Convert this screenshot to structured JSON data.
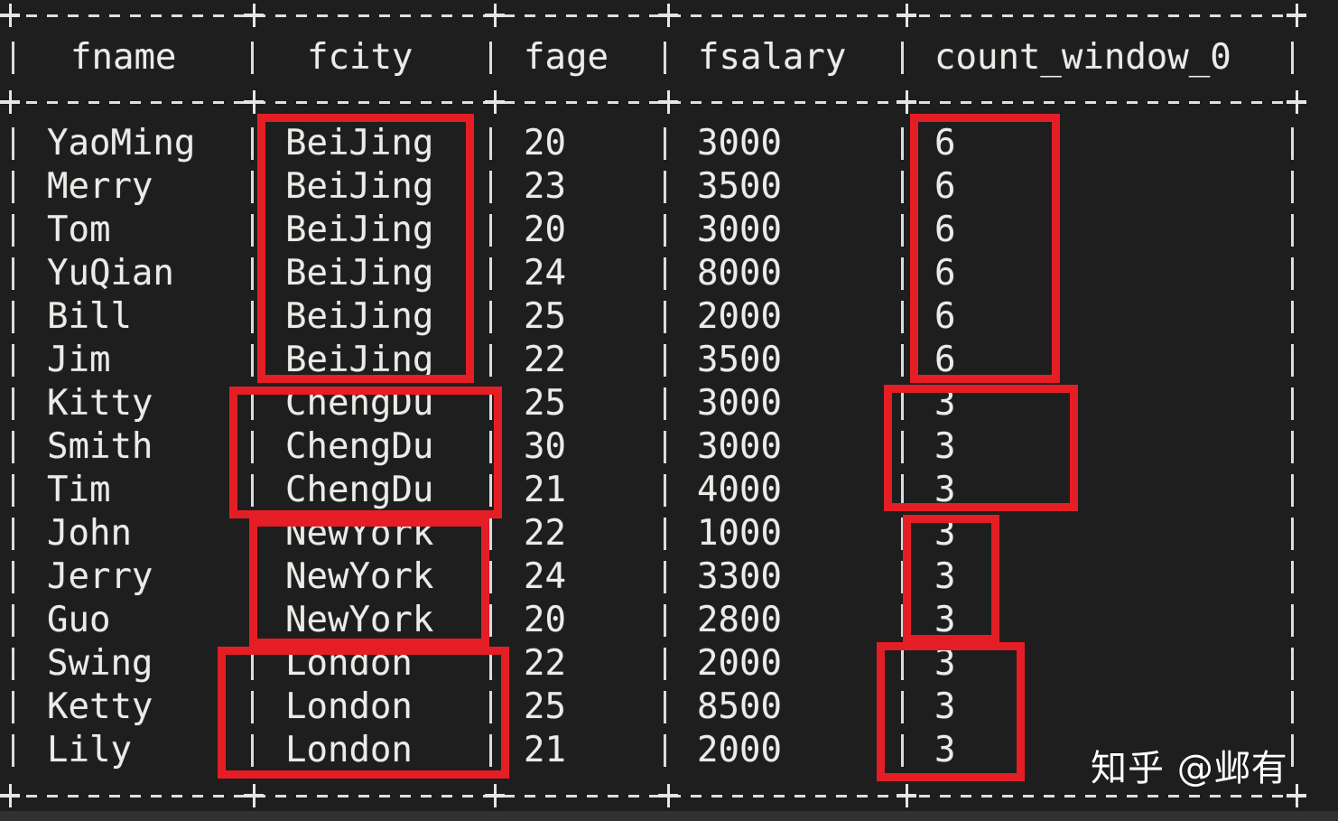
{
  "table": {
    "columns": [
      "fname",
      "fcity",
      "fage",
      "fsalary",
      "count_window_0"
    ],
    "rows": [
      [
        "YaoMing",
        "BeiJing",
        "20",
        "3000",
        "6"
      ],
      [
        "Merry",
        "BeiJing",
        "23",
        "3500",
        "6"
      ],
      [
        "Tom",
        "BeiJing",
        "20",
        "3000",
        "6"
      ],
      [
        "YuQian",
        "BeiJing",
        "24",
        "8000",
        "6"
      ],
      [
        "Bill",
        "BeiJing",
        "25",
        "2000",
        "6"
      ],
      [
        "Jim",
        "BeiJing",
        "22",
        "3500",
        "6"
      ],
      [
        "Kitty",
        "ChengDu",
        "25",
        "3000",
        "3"
      ],
      [
        "Smith",
        "ChengDu",
        "30",
        "3000",
        "3"
      ],
      [
        "Tim",
        "ChengDu",
        "21",
        "4000",
        "3"
      ],
      [
        "John",
        "NewYork",
        "22",
        "1000",
        "3"
      ],
      [
        "Jerry",
        "NewYork",
        "24",
        "3300",
        "3"
      ],
      [
        "Guo",
        "NewYork",
        "20",
        "2800",
        "3"
      ],
      [
        "Swing",
        "London",
        "22",
        "2000",
        "3"
      ],
      [
        "Ketty",
        "London",
        "25",
        "8500",
        "3"
      ],
      [
        "Lily",
        "London",
        "21",
        "2000",
        "3"
      ]
    ]
  },
  "highlight_groups": [
    {
      "city": "BeiJing",
      "count": "6",
      "rows": 6
    },
    {
      "city": "ChengDu",
      "count": "3",
      "rows": 3
    },
    {
      "city": "NewYork",
      "count": "3",
      "rows": 3
    },
    {
      "city": "London",
      "count": "3",
      "rows": 3
    }
  ],
  "colors": {
    "background": "#1e1e1e",
    "text": "#ecebe6",
    "highlight": "#e51e25"
  },
  "watermark": "知乎 @邺有"
}
